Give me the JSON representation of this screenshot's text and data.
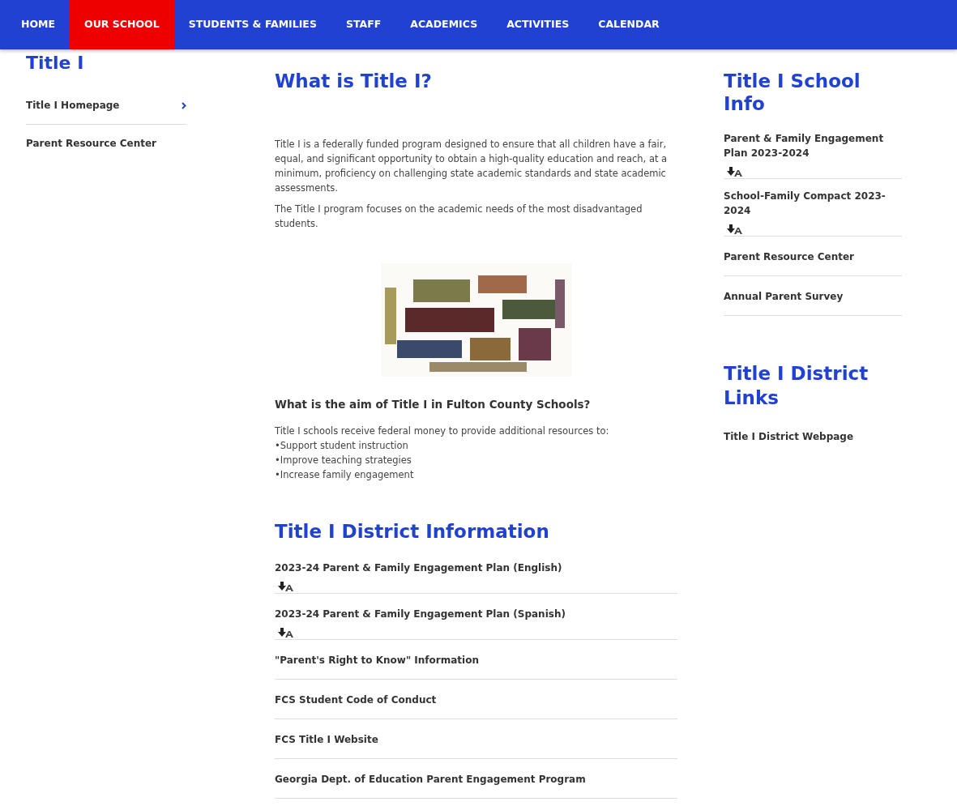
{
  "nav": [
    {
      "label": "HOME",
      "selected": false
    },
    {
      "label": "OUR SCHOOL",
      "selected": true
    },
    {
      "label": "STUDENTS & FAMILIES",
      "selected": false
    },
    {
      "label": "STAFF",
      "selected": false
    },
    {
      "label": "ACADEMICS",
      "selected": false
    },
    {
      "label": "ACTIVITIES",
      "selected": false
    },
    {
      "label": "CALENDAR",
      "selected": false
    }
  ],
  "sidebar": {
    "title": "Title I",
    "items": [
      {
        "label": "Title I Homepage",
        "selected": true
      },
      {
        "label": "Parent Resource Center",
        "selected": false
      }
    ]
  },
  "main": {
    "title": "What is Title I?",
    "paragraphs": [
      "Title I is a federally funded program designed to ensure that all children have a fair, equal, and significant opportunity to obtain a high-quality education and reach, at a minimum, proficiency on challenging state academic standards and state academic assessments.",
      "The Title I program focuses on the academic needs of the most disadvantaged students."
    ],
    "aim_heading": "What is the aim of Title I in Fulton County Schools?",
    "aim_lines": [
      "Title I schools receive federal money to provide additional resources to:",
      "•Support student instruction",
      "•Improve teaching strategies",
      "•Increase family engagement"
    ],
    "district_title": "Title I District Information",
    "district_links": [
      {
        "label": "2023-24 Parent & Family Engagement Plan (English)",
        "attachment": true
      },
      {
        "label": "2023-24 Parent & Family Engagement Plan (Spanish)",
        "attachment": true
      },
      {
        "label": "\"Parent's Right to Know\" Information",
        "attachment": false
      },
      {
        "label": "FCS Student Code of Conduct",
        "attachment": false
      },
      {
        "label": "FCS Title I Website",
        "attachment": false
      },
      {
        "label": "Georgia Dept. of Education Parent Engagement Program",
        "attachment": false
      }
    ]
  },
  "right": {
    "school_title": "Title I School Info",
    "school_links": [
      {
        "label": "Parent & Family Engagement Plan 2023-2024",
        "attachment": true
      },
      {
        "label": "School-Family Compact 2023-2024",
        "attachment": true
      },
      {
        "label": "Parent Resource Center",
        "attachment": false
      },
      {
        "label": "Annual Parent Survey",
        "attachment": false
      }
    ],
    "district_title": "Title I District Links",
    "district_links": [
      {
        "label": "Title I District Webpage",
        "attachment": false
      }
    ]
  }
}
